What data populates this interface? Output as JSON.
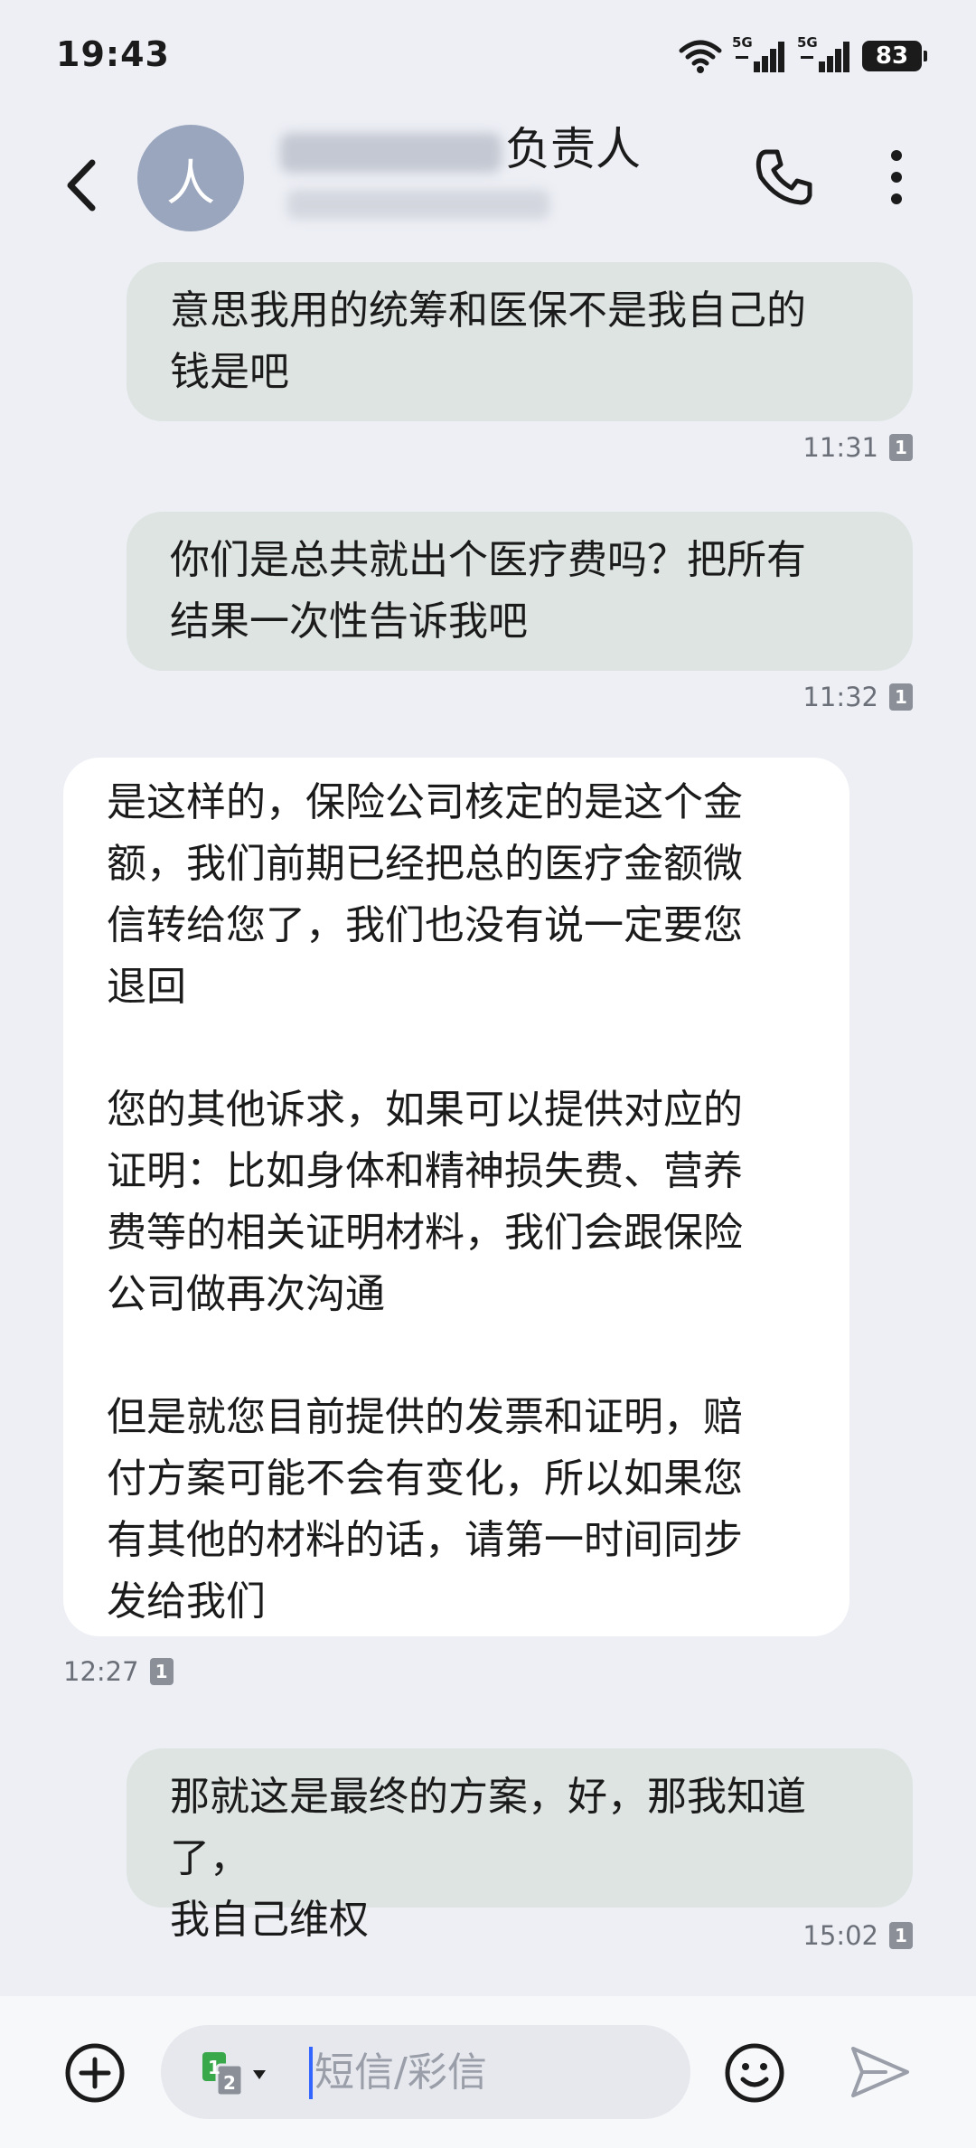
{
  "status_bar": {
    "time": "19:43",
    "signal_1_label": "5G",
    "signal_2_label": "5G",
    "battery": "83"
  },
  "header": {
    "avatar_letter": "人",
    "contact_name_visible": "负责人",
    "icons": [
      "back-icon",
      "phone-icon",
      "more-vert-icon"
    ]
  },
  "messages": [
    {
      "direction": "outgoing",
      "text": "意思我用的统筹和医保不是我自己的\n钱是吧",
      "time": "11:31",
      "sim": "1"
    },
    {
      "direction": "outgoing",
      "text": "你们是总共就出个医疗费吗？把所有\n结果一次性告诉我吧",
      "time": "11:32",
      "sim": "1"
    },
    {
      "direction": "incoming",
      "text": "是这样的，保险公司核定的是这个金\n额，我们前期已经把总的医疗金额微\n信转给您了，我们也没有说一定要您\n退回\n\n您的其他诉求，如果可以提供对应的\n证明：比如身体和精神损失费、营养\n费等的相关证明材料，我们会跟保险\n公司做再次沟通\n\n但是就您目前提供的发票和证明，赔\n付方案可能不会有变化，所以如果您\n有其他的材料的话，请第一时间同步\n发给我们",
      "time": "12:27",
      "sim": "1"
    },
    {
      "direction": "outgoing",
      "text": "那就这是最终的方案，好，那我知道了，\n我自己维权",
      "time": "15:02",
      "sim": "1"
    }
  ],
  "compose": {
    "placeholder": "短信/彩信",
    "sim_primary": "1",
    "sim_secondary": "2"
  },
  "colors": {
    "background": "#edeff5",
    "outgoing_bubble": "#dde4e1",
    "incoming_bubble": "#ffffff",
    "avatar": "#9aa6bd",
    "sim1_badge": "#39a84b",
    "cursor": "#3366ff"
  }
}
